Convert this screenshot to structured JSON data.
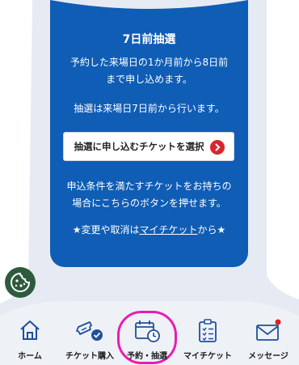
{
  "card": {
    "title": "7日前抽選",
    "desc_line1": "予約した来場日の1か月前から8日前",
    "desc_line2": "まで申し込めます。",
    "note": "抽選は来場日7日前から行います。",
    "select_button": "抽選に申し込むチケットを選択",
    "cond_line1": "申込条件を満たすチケットをお持ちの",
    "cond_line2": "場合にこちらのボタンを押せます。",
    "change_prefix": "★変更や取消は",
    "change_link": "マイチケット",
    "change_suffix": "から★"
  },
  "cookie": {
    "icon": "cookie-icon"
  },
  "tabs": [
    {
      "label": "ホーム",
      "icon": "home-icon"
    },
    {
      "label": "チケット購入",
      "icon": "ticket-check-icon"
    },
    {
      "label": "予約・抽選",
      "icon": "calendar-clock-icon",
      "selected": true
    },
    {
      "label": "マイチケット",
      "icon": "clipboard-list-icon"
    },
    {
      "label": "メッセージ",
      "icon": "envelope-icon",
      "badge": true
    }
  ],
  "colors": {
    "card": "#0f5db5",
    "ring": "#e61eb4",
    "badge": "#e02020",
    "cookie": "#2e5a3d",
    "chevron": "#d7262d"
  }
}
